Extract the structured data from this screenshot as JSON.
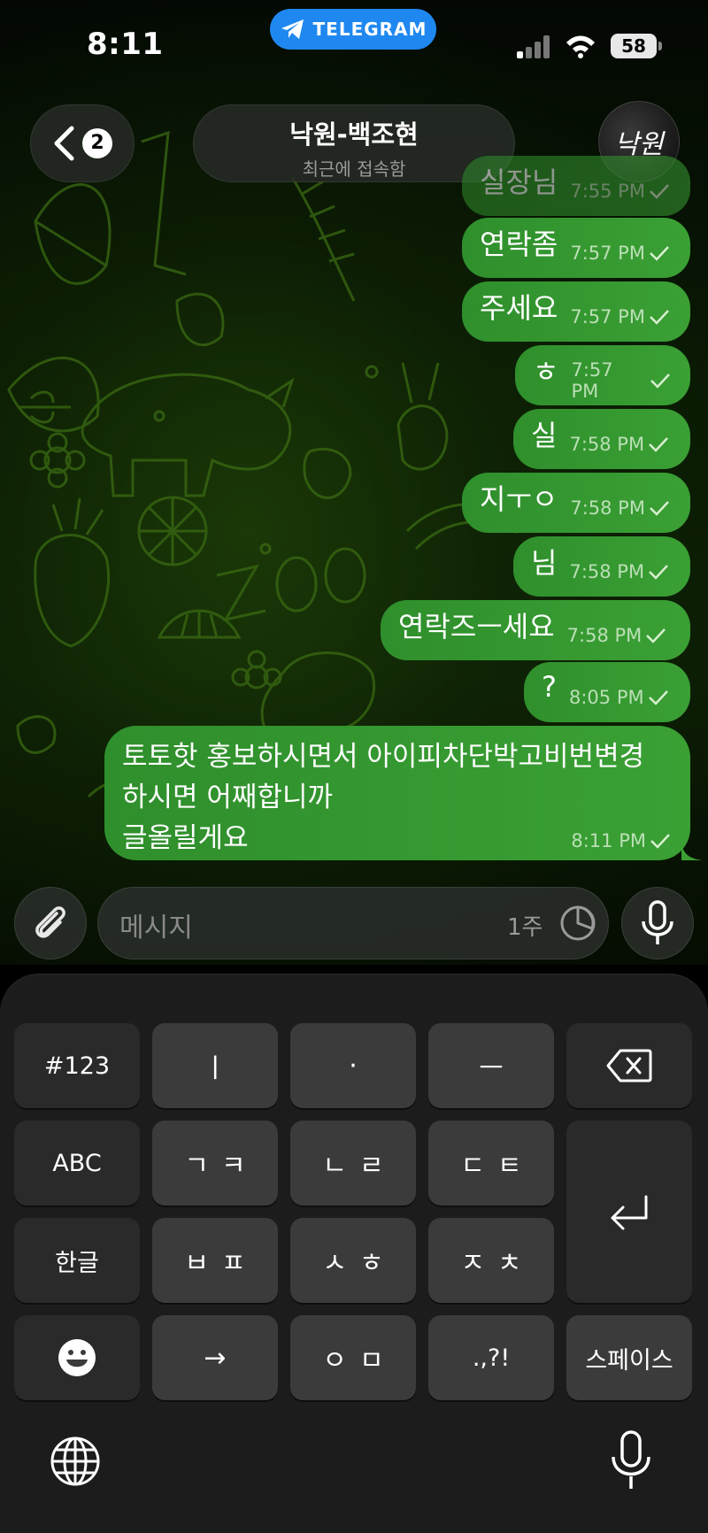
{
  "status_bar": {
    "time": "8:11",
    "app_pill": "TELEGRAM",
    "battery": "58",
    "accent": "#1f88f0"
  },
  "header": {
    "back_count": "2",
    "contact_name": "낙원-백조현",
    "contact_status": "최근에 접속함",
    "avatar_text": "낙원"
  },
  "messages": [
    {
      "text": "실장님",
      "time": "7:55 PM"
    },
    {
      "text": "연락좀",
      "time": "7:57 PM"
    },
    {
      "text": "주세요",
      "time": "7:57 PM"
    },
    {
      "text": "ㅎ",
      "time": "7:57 PM"
    },
    {
      "text": "실",
      "time": "7:58 PM"
    },
    {
      "text": "지ㅜㅇ",
      "time": "7:58 PM"
    },
    {
      "text": "님",
      "time": "7:58 PM"
    },
    {
      "text": "연락즈ㅡ세요",
      "time": "7:58 PM"
    },
    {
      "text": "?",
      "time": "8:05 PM"
    },
    {
      "text": "토토핫 홍보하시면서 아이피차단박고비번변경\n하시면 어째합니까\n글올릴게요",
      "time": "8:11 PM"
    }
  ],
  "bubble_color": "#3aa034",
  "input": {
    "placeholder": "메시지",
    "timer_label": "1주"
  },
  "keyboard": {
    "row1": [
      "#123",
      "ㅣ",
      "·",
      "ㅡ"
    ],
    "row2": [
      "ABC",
      "ㄱㅋ",
      "ㄴㄹ",
      "ㄷㅌ"
    ],
    "row3": [
      "한글",
      "ㅂㅍ",
      "ㅅㅎ",
      "ㅈㅊ"
    ],
    "row4": [
      "→",
      "ㅇㅁ",
      ".,?!",
      "스페이스"
    ]
  }
}
